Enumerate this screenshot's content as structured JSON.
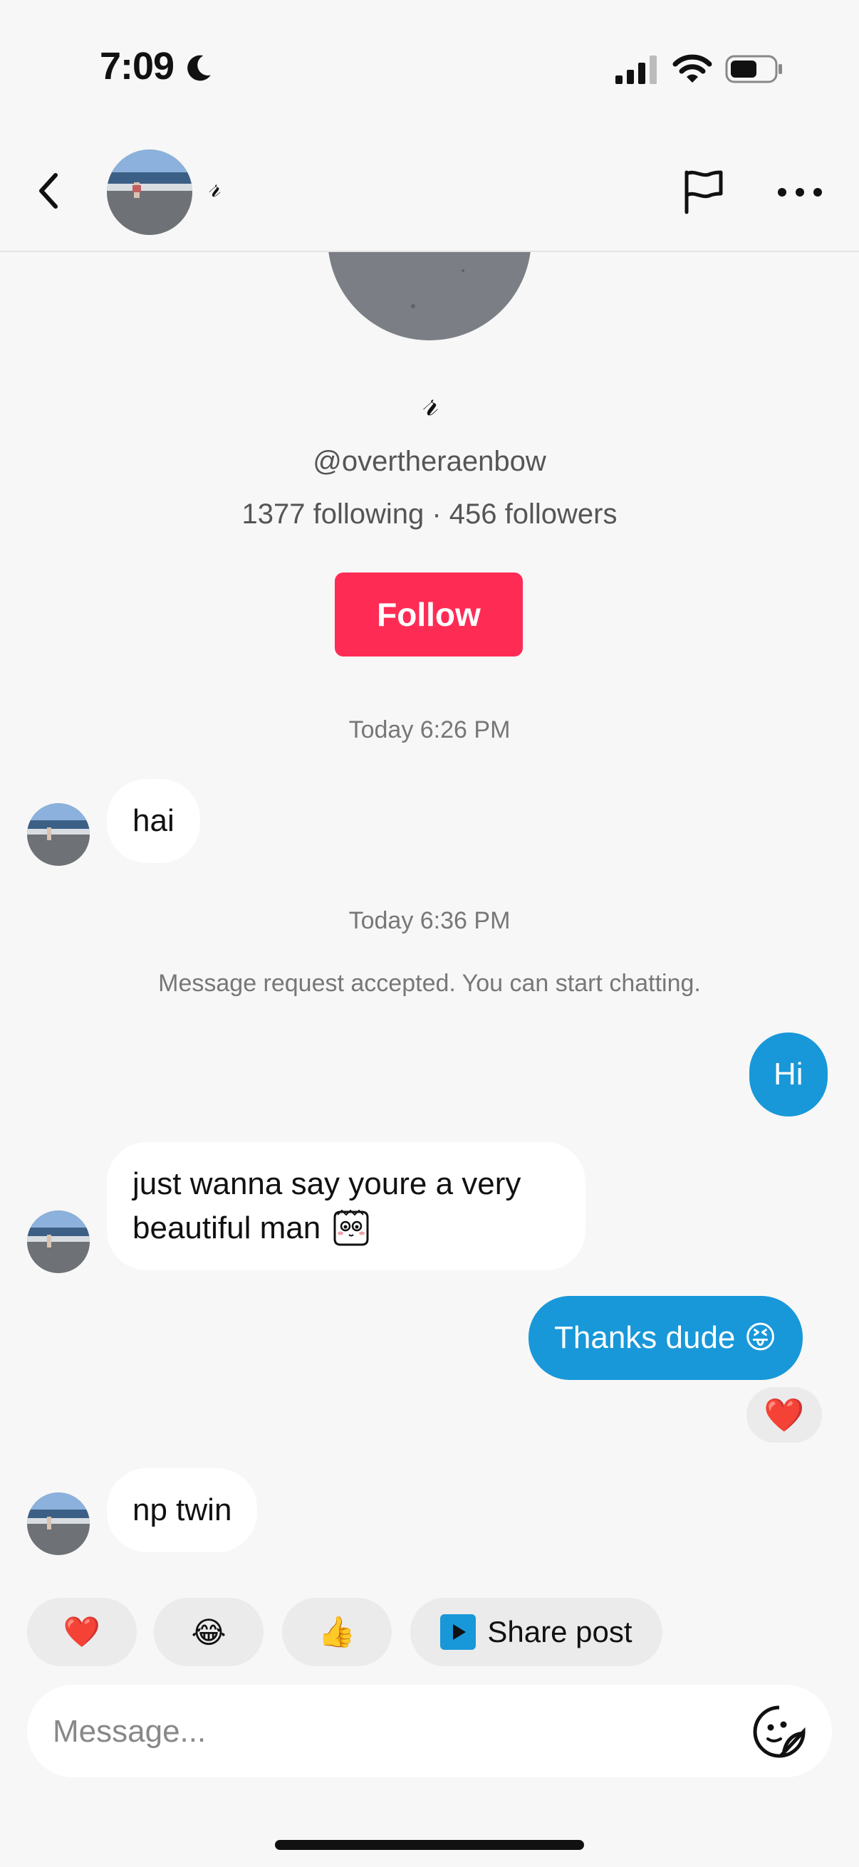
{
  "status_bar": {
    "time": "7:09",
    "icons": [
      "moon-icon",
      "cellular-signal-icon",
      "wifi-icon",
      "battery-icon"
    ]
  },
  "header": {
    "name": "𝓇",
    "icons": [
      "back-arrow-icon",
      "flag-icon",
      "more-dots-icon"
    ]
  },
  "profile": {
    "name": "𝓇",
    "handle": "@overtheraenbow",
    "stats": "1377 following · 456 followers",
    "follow_label": "Follow"
  },
  "conversation": {
    "timestamp_1": "Today 6:26 PM",
    "msg_1": "hai",
    "timestamp_2": "Today 6:36 PM",
    "system_notice": "Message request accepted. You can start chatting.",
    "msg_2": "Hi",
    "msg_3_line_1": "just wanna say youre a very",
    "msg_3_line_2": "beautiful man",
    "msg_4": "Thanks dude 😝",
    "msg_4_reaction": "❤️",
    "msg_5": "np twin"
  },
  "quick_replies": {
    "heart": "❤️",
    "laugh": "😂",
    "thumbs_up": "👍",
    "share_post": "Share post"
  },
  "composer": {
    "placeholder": "Message..."
  },
  "colors": {
    "follow": "#fe2c55",
    "outgoing_bubble": "#1898d9",
    "background": "#f7f7f7"
  }
}
